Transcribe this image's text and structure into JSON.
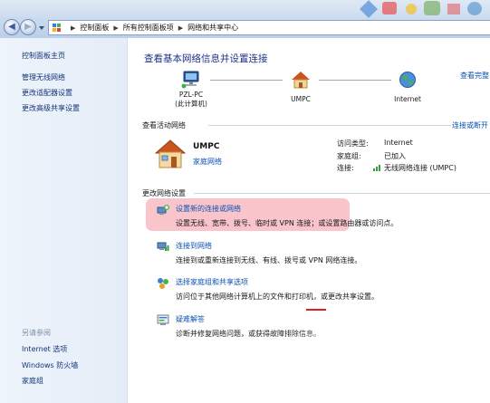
{
  "window": {
    "breadcrumbs": [
      "控制面板",
      "所有控制面板项",
      "网络和共享中心"
    ],
    "back_glyph": "◀",
    "forward_glyph": "▶"
  },
  "sidebar": {
    "home": "控制面板主页",
    "links": [
      "管理无线网络",
      "更改适配器设置",
      "更改高级共享设置"
    ],
    "see_also_title": "另请参阅",
    "see_also": [
      "Internet 选项",
      "Windows 防火墙",
      "家庭组"
    ]
  },
  "main": {
    "title": "查看基本网络信息并设置连接",
    "full_map_link": "查看完整",
    "map": {
      "computer_name": "PZL-PC",
      "computer_sub": "(此计算机)",
      "network_name": "UMPC",
      "internet_label": "Internet"
    },
    "active": {
      "heading": "查看活动网络",
      "connect_link": "连接或断开",
      "network_name": "UMPC",
      "network_type": "家庭网络",
      "access_type_label": "访问类型:",
      "access_type_value": "Internet",
      "homegroup_label": "家庭组:",
      "homegroup_value": "已加入",
      "connections_label": "连接:",
      "connections_value": "无线网络连接 (UMPC)"
    },
    "change": {
      "heading": "更改网络设置",
      "tasks": [
        {
          "title": "设置新的连接或网络",
          "desc": "设置无线、宽带、拨号、临时或 VPN 连接；或设置路由器或访问点。"
        },
        {
          "title": "连接到网络",
          "desc": "连接到或重新连接到无线、有线、拨号或 VPN 网络连接。"
        },
        {
          "title": "选择家庭组和共享选项",
          "desc": "访问位于其他网络计算机上的文件和打印机，或更改共享设置。"
        },
        {
          "title": "疑难解答",
          "desc": "诊断并修复网络问题，或获得故障排除信息。"
        }
      ]
    }
  },
  "colors": {
    "link": "#0b52b4",
    "title": "#1e3287",
    "highlight": "#f496a0",
    "sidebar_bg": "#e8f0fa"
  }
}
